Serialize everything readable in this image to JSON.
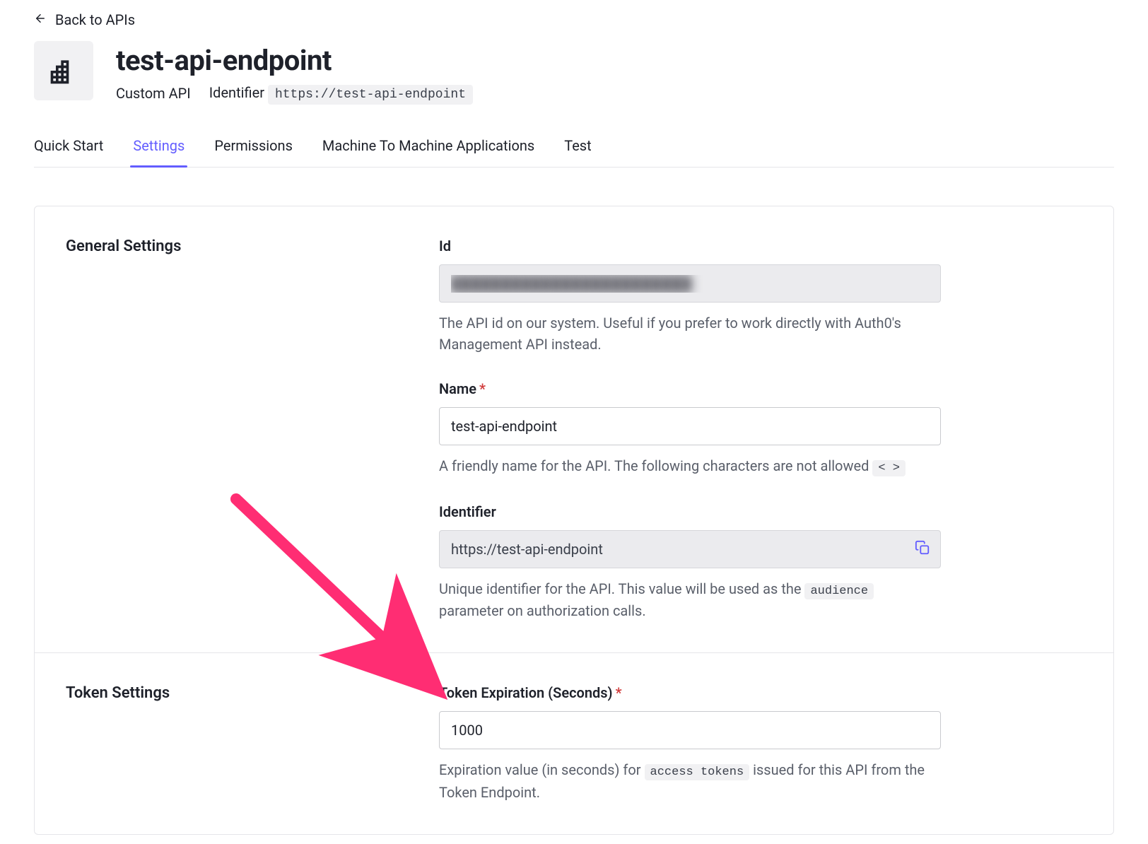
{
  "nav": {
    "back_label": "Back to APIs"
  },
  "header": {
    "title": "test-api-endpoint",
    "type_label": "Custom API",
    "identifier_label": "Identifier",
    "identifier_value": "https://test-api-endpoint"
  },
  "tabs": [
    {
      "label": "Quick Start",
      "active": false
    },
    {
      "label": "Settings",
      "active": true
    },
    {
      "label": "Permissions",
      "active": false
    },
    {
      "label": "Machine To Machine Applications",
      "active": false
    },
    {
      "label": "Test",
      "active": false
    }
  ],
  "sections": {
    "general": {
      "title": "General Settings",
      "fields": {
        "id": {
          "label": "Id",
          "value": "████████████████████████",
          "help": "The API id on our system. Useful if you prefer to work directly with Auth0's Management API instead."
        },
        "name": {
          "label": "Name",
          "required": true,
          "value": "test-api-endpoint",
          "help_pre": "A friendly name for the API. The following characters are not allowed ",
          "help_code": "< >"
        },
        "identifier": {
          "label": "Identifier",
          "value": "https://test-api-endpoint",
          "help_pre": "Unique identifier for the API. This value will be used as the ",
          "help_code": "audience",
          "help_post": " parameter on authorization calls."
        }
      }
    },
    "token": {
      "title": "Token Settings",
      "fields": {
        "expiration": {
          "label": "Token Expiration (Seconds)",
          "required": true,
          "value": "1000",
          "help_pre": "Expiration value (in seconds) for ",
          "help_code": "access tokens",
          "help_post": " issued for this API from the Token Endpoint."
        }
      }
    }
  },
  "annotation": {
    "arrow_color": "#ff2d73"
  }
}
